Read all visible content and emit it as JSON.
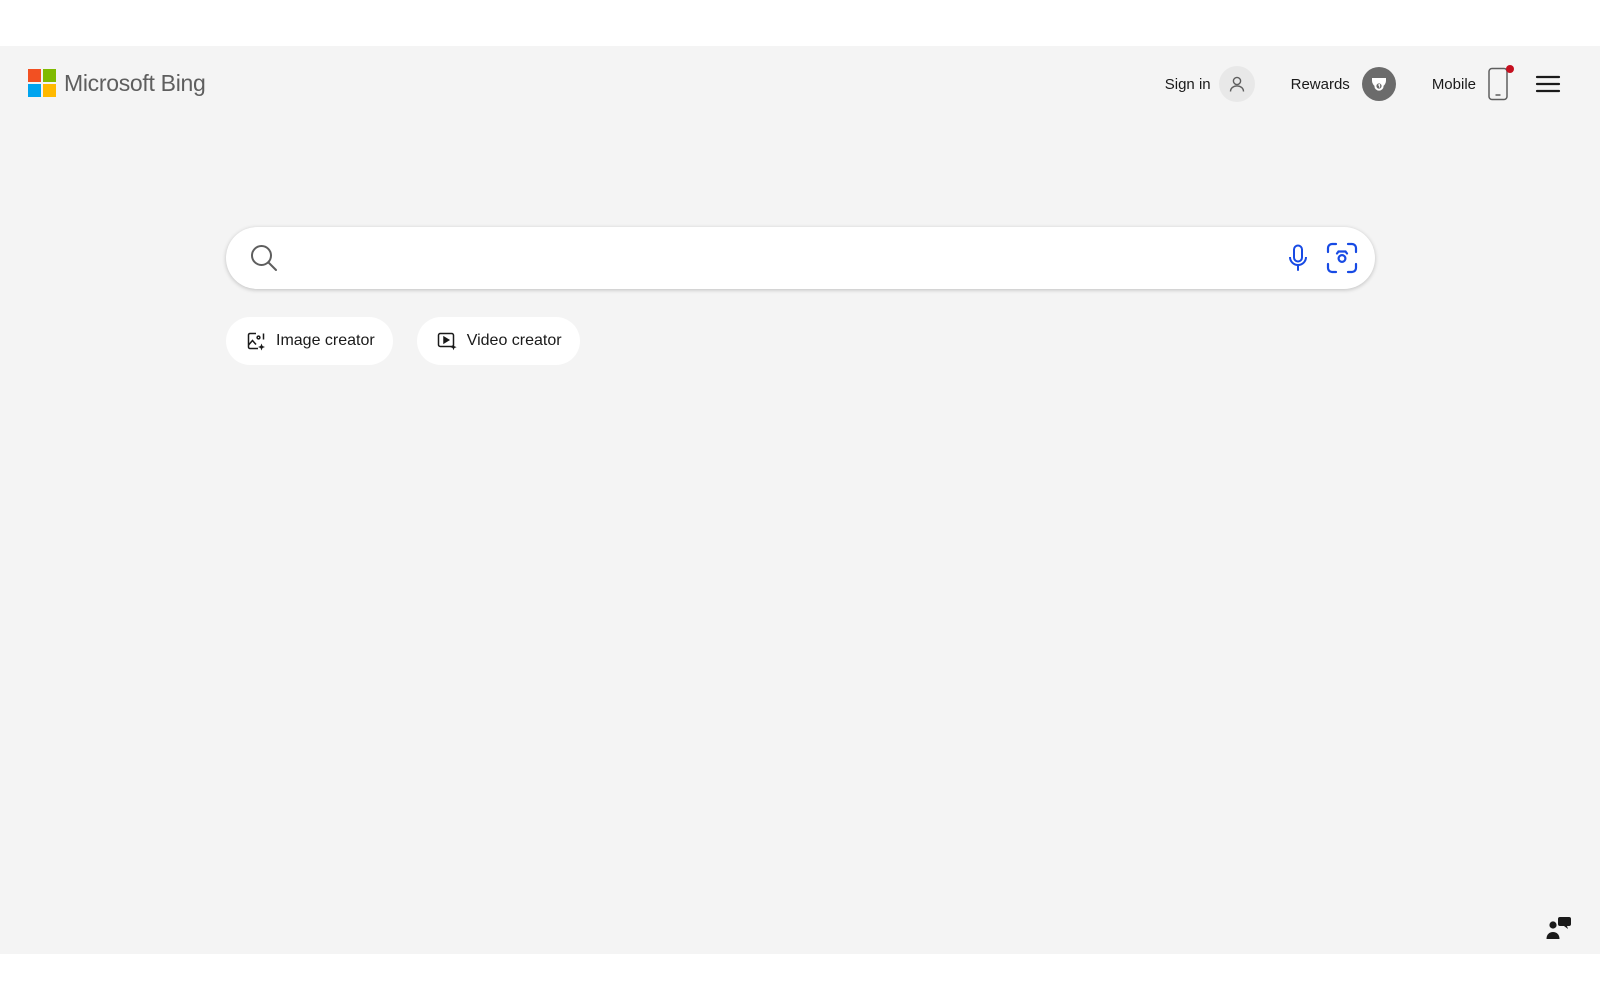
{
  "header": {
    "logo_text": "Microsoft Bing",
    "sign_in_label": "Sign in",
    "rewards_label": "Rewards",
    "mobile_label": "Mobile"
  },
  "search": {
    "placeholder": "",
    "value": ""
  },
  "chips": [
    {
      "label": "Image creator",
      "icon": "image-creator-icon"
    },
    {
      "label": "Video creator",
      "icon": "video-creator-icon"
    }
  ],
  "colors": {
    "page_background": "#f4f4f4",
    "ms_red": "#f25022",
    "ms_green": "#7fba00",
    "ms_blue": "#00a4ef",
    "ms_yellow": "#ffb900",
    "accent_blue": "#174ae4",
    "notification_red": "#c50f1f"
  },
  "icons": {
    "search": "search-icon",
    "microphone": "microphone-icon",
    "visual_search": "camera-search-icon",
    "user": "user-icon",
    "rewards": "rewards-trophy-icon",
    "mobile": "phone-icon",
    "menu": "hamburger-menu-icon",
    "feedback": "feedback-icon"
  }
}
